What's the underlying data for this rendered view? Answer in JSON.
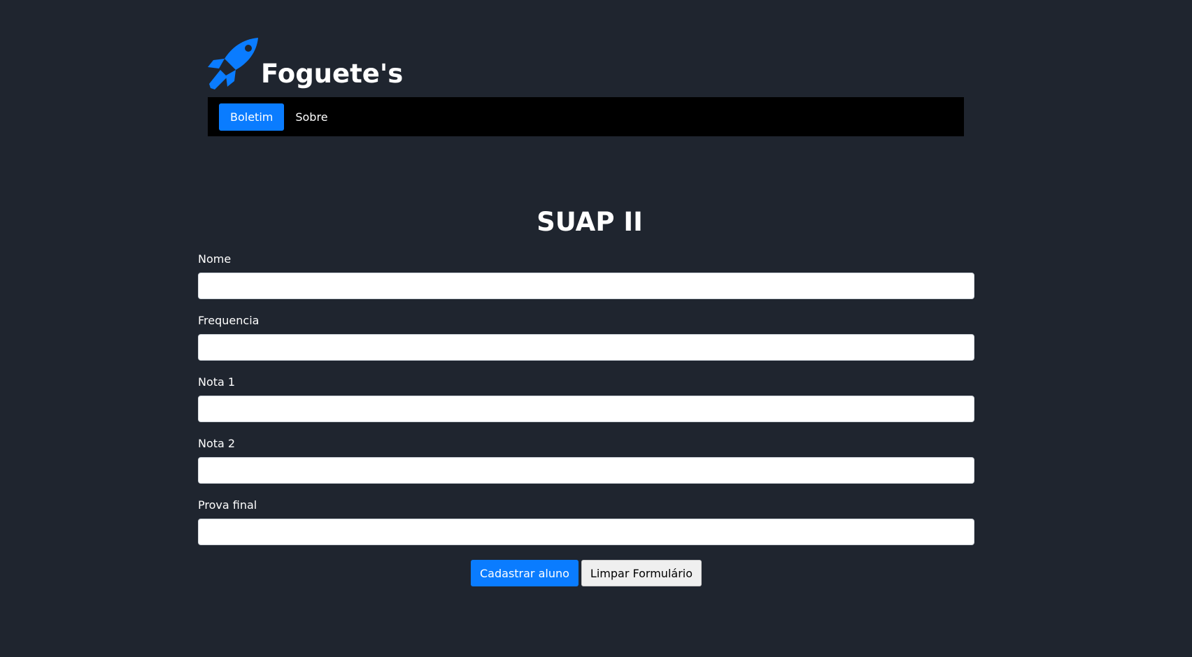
{
  "brand": {
    "title": "Foguete's",
    "icon": "rocket-icon",
    "color": "#0a7cff"
  },
  "nav": {
    "items": [
      {
        "label": "Boletim",
        "active": true
      },
      {
        "label": "Sobre",
        "active": false
      }
    ]
  },
  "page": {
    "title": "SUAP II"
  },
  "form": {
    "fields": [
      {
        "label": "Nome",
        "value": "",
        "placeholder": ""
      },
      {
        "label": "Frequencia",
        "value": "",
        "placeholder": ""
      },
      {
        "label": "Nota 1",
        "value": "",
        "placeholder": ""
      },
      {
        "label": "Nota 2",
        "value": "",
        "placeholder": ""
      },
      {
        "label": "Prova final",
        "value": "",
        "placeholder": ""
      }
    ],
    "submit_label": "Cadastrar aluno",
    "reset_label": "Limpar Formulário"
  },
  "colors": {
    "background": "#1f252f",
    "navbar": "#000000",
    "accent": "#0a7cff"
  }
}
